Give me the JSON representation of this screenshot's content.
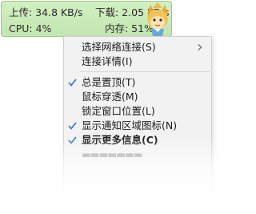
{
  "monitor": {
    "upload": "上传: 34.8 KB/s",
    "download": "下载: 2.05 KB/s",
    "cpu": "CPU: 4%",
    "memory": "内存: 51%"
  },
  "menu": {
    "items": [
      {
        "label": "选择网络连接(S)",
        "checked": false,
        "submenu": true
      },
      {
        "label": "连接详情(I)",
        "checked": false
      },
      {
        "label": "总是置顶(T)",
        "checked": true
      },
      {
        "label": "鼠标穿透(M)",
        "checked": false
      },
      {
        "label": "锁定窗口位置(L)",
        "checked": false
      },
      {
        "label": "显示通知区域图标(N)",
        "checked": true
      },
      {
        "label": "显示更多信息(C)",
        "checked": true,
        "bold": true
      }
    ]
  },
  "colors": {
    "widget_bg": "#c8eab8",
    "widget_border": "#9bc98b",
    "check": "#2f6fc9"
  }
}
